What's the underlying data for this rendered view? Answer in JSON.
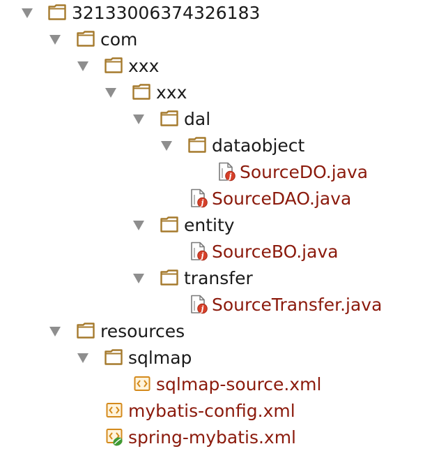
{
  "colors": {
    "folder_stroke": "#a57a2d",
    "folder_fill": "#ffffff",
    "triangle": "#8e8e8e",
    "folder_label": "#1a1a1a",
    "file_label": "#8b1a0c",
    "java_badge": "#d6402a",
    "xml_icon": "#d48a1c",
    "spring_badge": "#3f9a34"
  },
  "tree": [
    {
      "label": "32133006374326183",
      "type": "folder",
      "expanded": true,
      "icon": "folder-icon"
    },
    {
      "label": "com",
      "type": "folder",
      "expanded": true,
      "icon": "folder-icon"
    },
    {
      "label": "xxx",
      "type": "folder",
      "expanded": true,
      "icon": "folder-icon"
    },
    {
      "label": "xxx",
      "type": "folder",
      "expanded": true,
      "icon": "folder-icon"
    },
    {
      "label": "dal",
      "type": "folder",
      "expanded": true,
      "icon": "folder-icon"
    },
    {
      "label": "dataobject",
      "type": "folder",
      "expanded": true,
      "icon": "folder-icon"
    },
    {
      "label": "SourceDO.java",
      "type": "java",
      "icon": "java-class-icon"
    },
    {
      "label": "SourceDAO.java",
      "type": "java",
      "icon": "java-class-icon"
    },
    {
      "label": "entity",
      "type": "folder",
      "expanded": true,
      "icon": "folder-icon"
    },
    {
      "label": "SourceBO.java",
      "type": "java",
      "icon": "java-class-icon"
    },
    {
      "label": "transfer",
      "type": "folder",
      "expanded": true,
      "icon": "folder-icon"
    },
    {
      "label": "SourceTransfer.java",
      "type": "java",
      "icon": "java-class-icon"
    },
    {
      "label": "resources",
      "type": "folder",
      "expanded": true,
      "icon": "folder-icon"
    },
    {
      "label": "sqlmap",
      "type": "folder",
      "expanded": true,
      "icon": "folder-icon"
    },
    {
      "label": "sqlmap-source.xml",
      "type": "xml",
      "icon": "xml-file-icon"
    },
    {
      "label": "mybatis-config.xml",
      "type": "xml",
      "icon": "xml-file-icon"
    },
    {
      "label": "spring-mybatis.xml",
      "type": "spring",
      "icon": "spring-xml-file-icon"
    }
  ]
}
